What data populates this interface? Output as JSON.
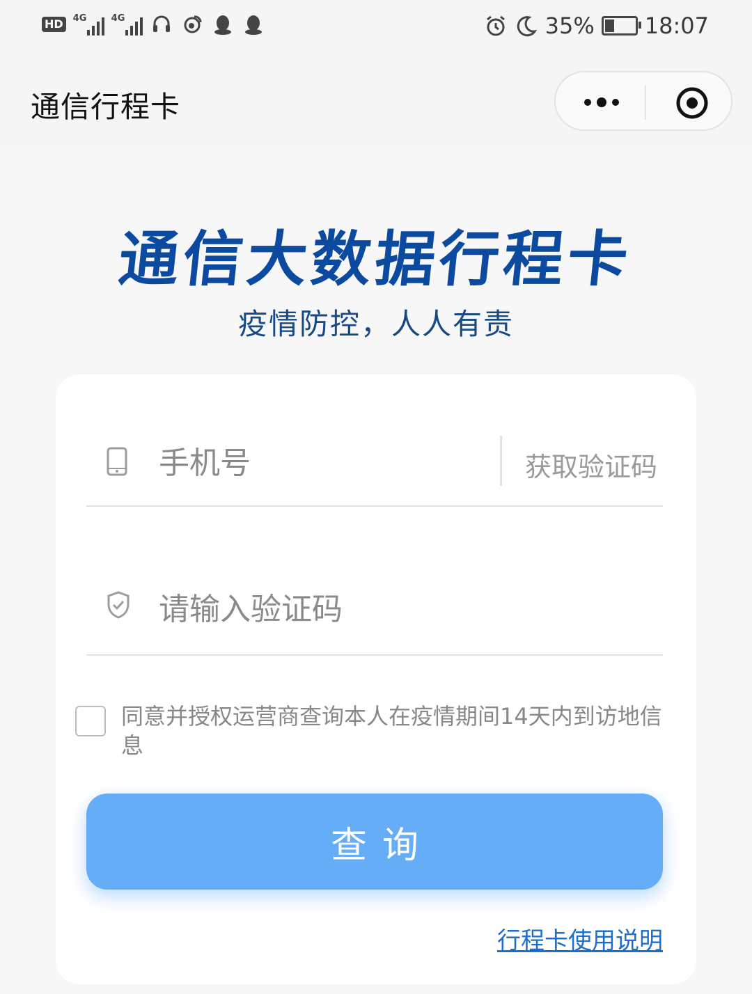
{
  "status_bar": {
    "left_labels": {
      "hd": "HD",
      "sim1_network": "4G",
      "sim2_network": "4G"
    },
    "left_icons": [
      "hd-icon",
      "signal-4g-icon",
      "signal-4g-icon",
      "headset-icon",
      "weibo-icon",
      "qq-icon",
      "qq-icon"
    ],
    "right_icons": [
      "alarm-icon",
      "moon-icon"
    ],
    "battery_percent": "35%",
    "battery_level": 0.35,
    "charging": true,
    "time": "18:07"
  },
  "nav": {
    "title": "通信行程卡",
    "capsule_icons": [
      "more-dots-icon",
      "close-target-icon"
    ]
  },
  "header": {
    "title": "通信大数据行程卡",
    "subtitle": "疫情防控，人人有责"
  },
  "form": {
    "phone": {
      "placeholder": "手机号",
      "value": "",
      "icon": "phone-icon"
    },
    "get_code_label": "获取验证码",
    "code": {
      "placeholder": "请输入验证码",
      "value": "",
      "icon": "shield-check-icon"
    },
    "agreement": {
      "checked": false,
      "text": "同意并授权运营商查询本人在疫情期间14天内到访地信息"
    },
    "submit_label": "查询",
    "help_link": "行程卡使用说明"
  },
  "colors": {
    "title_blue": "#0c4aa0",
    "subtitle_blue": "#174a85",
    "button_blue": "#65adf7",
    "link_blue": "#1c6ecf"
  }
}
